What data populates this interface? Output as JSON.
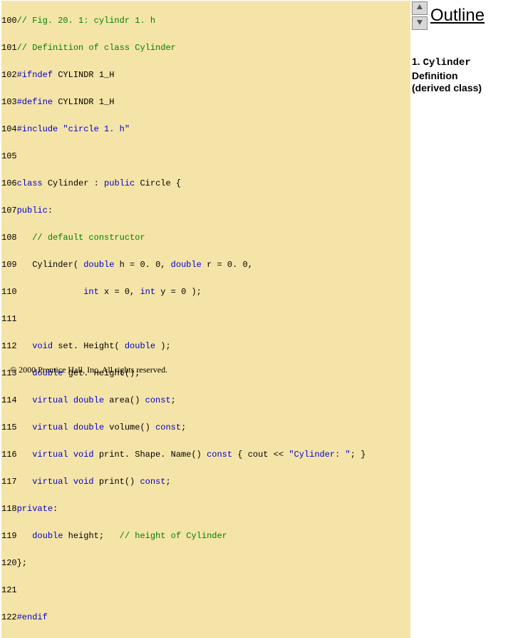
{
  "outline_title": "Outline",
  "section": {
    "num": "1. ",
    "name": "Cylinder",
    "rest": " Definition",
    "sub": "(derived class)"
  },
  "nav": {
    "up_icon": "up-arrow-icon",
    "down_icon": "down-arrow-icon"
  },
  "code": {
    "l100": {
      "ln": "100",
      "cmt": "// Fig. 20. 1: cylindr 1. h"
    },
    "l101": {
      "ln": "101",
      "cmt": "// Definition of class Cylinder"
    },
    "l102": {
      "ln": "102",
      "pp": "#ifndef ",
      "id": "CYLINDR 1_H"
    },
    "l103": {
      "ln": "103",
      "pp": "#define ",
      "id": "CYLINDR 1_H"
    },
    "l104": {
      "ln": "104",
      "pp": "#include ",
      "q": "\"circle 1. h\""
    },
    "l105": {
      "ln": "105"
    },
    "l106": {
      "ln": "106",
      "k1": "class",
      "t1": " Cylinder : ",
      "k2": "public",
      "t2": " Circle {"
    },
    "l107": {
      "ln": "107",
      "k1": "public",
      "t1": ":"
    },
    "l108": {
      "ln": "108",
      "cmt": "   // default constructor"
    },
    "l109": {
      "ln": "109",
      "t0": "   Cylinder( ",
      "k1": "double",
      "t1": " h = 0. 0, ",
      "k2": "double",
      "t2": " r = 0. 0,"
    },
    "l110": {
      "ln": "110",
      "t0": "             ",
      "k1": "int",
      "t1": " x = 0, ",
      "k2": "int",
      "t2": " y = 0 ); "
    },
    "l111": {
      "ln": "111"
    },
    "l112": {
      "ln": "112",
      "t0": "   ",
      "k1": "void",
      "t1": " set. Height( ",
      "k2": "double",
      "t2": " );"
    },
    "l113": {
      "ln": "113",
      "t0": "   ",
      "k1": "double",
      "t1": " get. Height();"
    },
    "l114": {
      "ln": "114",
      "t0": "   ",
      "k1": "virtual double",
      "t1": " area() ",
      "k2": "const",
      "t2": ";"
    },
    "l115": {
      "ln": "115",
      "t0": "   ",
      "k1": "virtual double",
      "t1": " volume() ",
      "k2": "const",
      "t2": ";"
    },
    "l116": {
      "ln": "116",
      "t0": "   ",
      "k1": "virtual void",
      "t1": " print. Shape. Name() ",
      "k2": "const",
      "t2": " { cout << ",
      "q": "\"Cylinder: \"",
      "t3": "; }"
    },
    "l117": {
      "ln": "117",
      "t0": "   ",
      "k1": "virtual void",
      "t1": " print() ",
      "k2": "const",
      "t2": ";"
    },
    "l118": {
      "ln": "118",
      "k1": "private",
      "t1": ":"
    },
    "l119": {
      "ln": "119",
      "t0": "   ",
      "k1": "double",
      "t1": " height;   ",
      "cmt": "// height of Cylinder"
    },
    "l120": {
      "ln": "120",
      "t1": "};"
    },
    "l121": {
      "ln": "121"
    },
    "l122": {
      "ln": "122",
      "pp": "#endif"
    }
  },
  "footer": "© 2000 Prentice Hall, Inc. All rights reserved."
}
